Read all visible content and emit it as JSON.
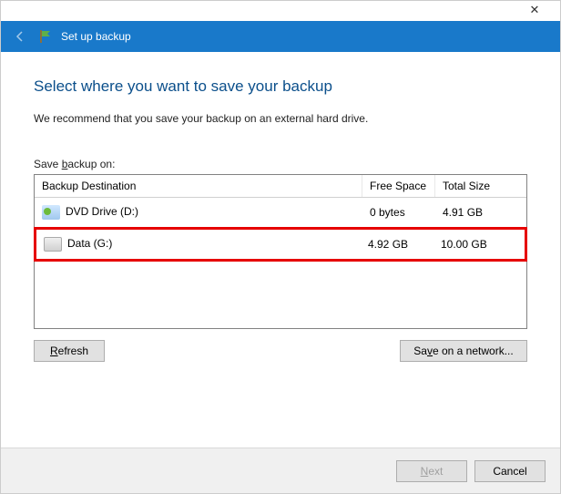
{
  "window": {
    "title": "Set up backup"
  },
  "page": {
    "heading": "Select where you want to save your backup",
    "recommend": "We recommend that you save your backup on an external hard drive.",
    "saveLabel_pre": "Save ",
    "saveLabel_u": "b",
    "saveLabel_post": "ackup on:"
  },
  "table": {
    "headers": {
      "destination": "Backup Destination",
      "free": "Free Space",
      "total": "Total Size"
    },
    "rows": [
      {
        "icon": "dvd",
        "name": "DVD Drive (D:)",
        "free": "0 bytes",
        "total": "4.91 GB",
        "highlighted": false
      },
      {
        "icon": "hdd",
        "name": "Data (G:)",
        "free": "4.92 GB",
        "total": "10.00 GB",
        "highlighted": true
      }
    ]
  },
  "buttons": {
    "refresh_u": "R",
    "refresh_post": "efresh",
    "saveNetwork_pre": "Sa",
    "saveNetwork_u": "v",
    "saveNetwork_post": "e on a network...",
    "next_u": "N",
    "next_post": "ext",
    "cancel": "Cancel"
  }
}
